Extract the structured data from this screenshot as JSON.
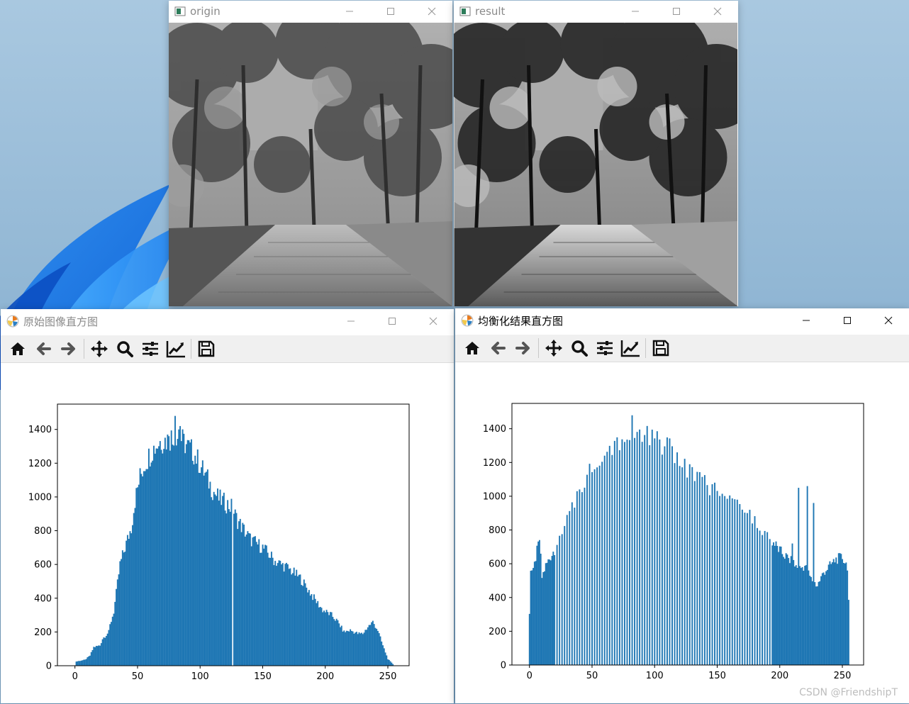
{
  "windows": {
    "origin": {
      "title": "origin"
    },
    "result": {
      "title": "result"
    },
    "hist_original": {
      "title": "原始图像直方图",
      "toolbar": [
        "home-icon",
        "back-icon",
        "forward-icon",
        "pan-icon",
        "zoom-icon",
        "configure-subplots-icon",
        "edit-axis-icon",
        "save-icon"
      ]
    },
    "hist_equalized": {
      "title": "均衡化结果直方图",
      "toolbar": [
        "home-icon",
        "back-icon",
        "forward-icon",
        "pan-icon",
        "zoom-icon",
        "configure-subplots-icon",
        "edit-axis-icon",
        "save-icon"
      ]
    }
  },
  "watermark": "CSDN @FriendshipT",
  "colors": {
    "bar": "#1f77b4",
    "title_inactive": "#8a8a8a",
    "title_active": "#000000"
  },
  "chart_data": [
    {
      "type": "bar",
      "xlim": [
        -14,
        267
      ],
      "ylim": [
        0,
        1550
      ],
      "xticks": [
        0,
        50,
        100,
        150,
        200,
        250
      ],
      "yticks": [
        0,
        200,
        400,
        600,
        800,
        1000,
        1200,
        1400
      ],
      "anchors": [
        [
          0,
          0
        ],
        [
          1,
          25
        ],
        [
          8,
          35
        ],
        [
          12,
          60
        ],
        [
          15,
          110
        ],
        [
          20,
          120
        ],
        [
          22,
          160
        ],
        [
          27,
          200
        ],
        [
          28,
          240
        ],
        [
          31,
          320
        ],
        [
          33,
          430
        ],
        [
          36,
          600
        ],
        [
          40,
          700
        ],
        [
          45,
          820
        ],
        [
          48,
          980
        ],
        [
          52,
          1120
        ],
        [
          56,
          1200
        ],
        [
          62,
          1280
        ],
        [
          68,
          1330
        ],
        [
          75,
          1340
        ],
        [
          80,
          1380
        ],
        [
          85,
          1340
        ],
        [
          90,
          1300
        ],
        [
          95,
          1260
        ],
        [
          100,
          1190
        ],
        [
          105,
          1120
        ],
        [
          110,
          1040
        ],
        [
          115,
          990
        ],
        [
          125,
          940
        ],
        [
          130,
          860
        ],
        [
          140,
          750
        ],
        [
          150,
          700
        ],
        [
          160,
          620
        ],
        [
          170,
          580
        ],
        [
          180,
          520
        ],
        [
          190,
          410
        ],
        [
          198,
          330
        ],
        [
          205,
          300
        ],
        [
          210,
          260
        ],
        [
          215,
          200
        ],
        [
          220,
          210
        ],
        [
          226,
          190
        ],
        [
          230,
          190
        ],
        [
          234,
          230
        ],
        [
          238,
          260
        ],
        [
          242,
          210
        ],
        [
          246,
          120
        ],
        [
          250,
          40
        ],
        [
          254,
          10
        ],
        [
          255,
          0
        ]
      ],
      "gaps": [
        126
      ],
      "spikes": [
        [
          80,
          1480
        ],
        [
          83,
          1400
        ],
        [
          84,
          1420
        ],
        [
          75,
          1360
        ],
        [
          78,
          1310
        ]
      ],
      "note_values_estimated_from_gridlines": true
    },
    {
      "type": "bar",
      "xlim": [
        -14,
        267
      ],
      "ylim": [
        0,
        1550
      ],
      "xticks": [
        0,
        50,
        100,
        150,
        200,
        250
      ],
      "yticks": [
        0,
        200,
        400,
        600,
        800,
        1000,
        1200,
        1400
      ],
      "anchors": [
        [
          0,
          320
        ],
        [
          1,
          580
        ],
        [
          3,
          560
        ],
        [
          5,
          650
        ],
        [
          8,
          760
        ],
        [
          10,
          530
        ],
        [
          13,
          600
        ],
        [
          20,
          700
        ],
        [
          25,
          780
        ],
        [
          30,
          870
        ],
        [
          35,
          960
        ],
        [
          40,
          1060
        ],
        [
          45,
          1130
        ],
        [
          50,
          1200
        ],
        [
          55,
          1260
        ],
        [
          60,
          1300
        ],
        [
          65,
          1330
        ],
        [
          70,
          1350
        ],
        [
          75,
          1380
        ],
        [
          80,
          1380
        ],
        [
          83,
          1480
        ],
        [
          85,
          1370
        ],
        [
          90,
          1400
        ],
        [
          100,
          1360
        ],
        [
          110,
          1320
        ],
        [
          120,
          1240
        ],
        [
          130,
          1160
        ],
        [
          140,
          1100
        ],
        [
          150,
          1050
        ],
        [
          160,
          1000
        ],
        [
          170,
          950
        ],
        [
          180,
          880
        ],
        [
          190,
          780
        ],
        [
          195,
          740
        ],
        [
          200,
          690
        ],
        [
          210,
          620
        ],
        [
          215,
          580
        ],
        [
          220,
          600
        ],
        [
          225,
          520
        ],
        [
          230,
          480
        ],
        [
          235,
          560
        ],
        [
          240,
          600
        ],
        [
          245,
          640
        ],
        [
          250,
          650
        ],
        [
          254,
          600
        ],
        [
          255,
          390
        ]
      ],
      "gaps_every_other": true,
      "spikes": [
        [
          215,
          1050
        ],
        [
          222,
          1060
        ],
        [
          227,
          960
        ],
        [
          210,
          720
        ]
      ],
      "note_values_estimated_from_gridlines": true
    }
  ]
}
